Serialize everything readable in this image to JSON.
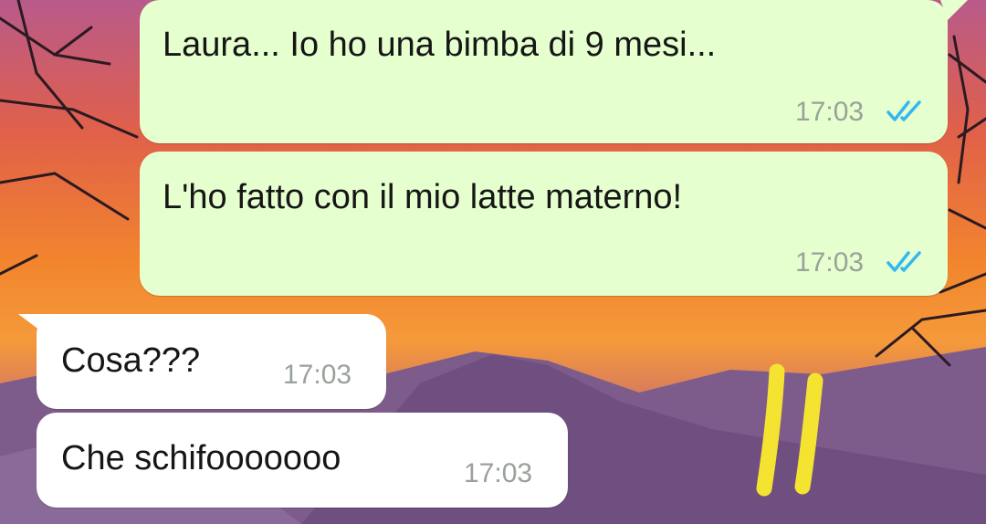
{
  "colors": {
    "outgoing_bubble": "#e6ffcf",
    "incoming_bubble": "#ffffff",
    "read_ticks": "#34b7f1",
    "timestamp": "#9aa19a",
    "annotation_mark": "#f5e332"
  },
  "messages": [
    {
      "direction": "outgoing",
      "text": "Laura... Io ho una bimba di 9 mesi...",
      "time": "17:03",
      "status_icon": "double-check-read-icon"
    },
    {
      "direction": "outgoing",
      "text": "L'ho fatto con il mio latte materno!",
      "time": "17:03",
      "status_icon": "double-check-read-icon"
    },
    {
      "direction": "incoming",
      "text": "Cosa???",
      "time": "17:03"
    },
    {
      "direction": "incoming",
      "text": "Che schifooooooo",
      "time": "17:03"
    }
  ]
}
